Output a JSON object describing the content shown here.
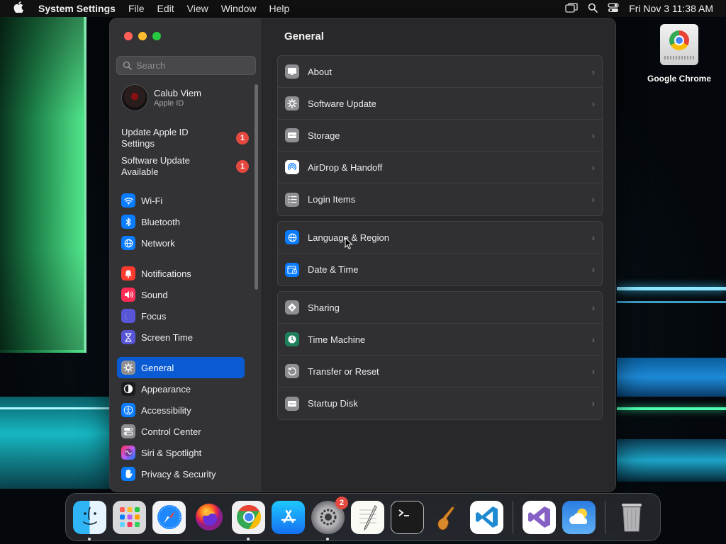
{
  "menubar": {
    "app_name": "System Settings",
    "items": [
      "File",
      "Edit",
      "View",
      "Window",
      "Help"
    ],
    "clock": "Fri Nov 3  11:38 AM"
  },
  "desktop": {
    "icon_label": "Google Chrome"
  },
  "window": {
    "search_placeholder": "Search",
    "account": {
      "name": "Calub Viem",
      "subtitle": "Apple ID"
    },
    "notices": [
      {
        "text": "Update Apple ID Settings",
        "badge": "1"
      },
      {
        "text": "Software Update Available",
        "badge": "1"
      }
    ],
    "sidebar_groups": [
      [
        {
          "label": "Wi-Fi",
          "icon": "wifi-icon",
          "color": "#0a7cff"
        },
        {
          "label": "Bluetooth",
          "icon": "bluetooth-icon",
          "color": "#0a7cff"
        },
        {
          "label": "Network",
          "icon": "globe-icon",
          "color": "#0a7cff"
        }
      ],
      [
        {
          "label": "Notifications",
          "icon": "bell-icon",
          "color": "#ff3b30"
        },
        {
          "label": "Sound",
          "icon": "speaker-icon",
          "color": "#ff2d55"
        },
        {
          "label": "Focus",
          "icon": "moon-icon",
          "color": "#5856d6"
        },
        {
          "label": "Screen Time",
          "icon": "hourglass-icon",
          "color": "#5856d6"
        }
      ],
      [
        {
          "label": "General",
          "icon": "gear-icon",
          "color": "#8e8e93",
          "active": true
        },
        {
          "label": "Appearance",
          "icon": "appearance-icon",
          "color": "#1c1c1e"
        },
        {
          "label": "Accessibility",
          "icon": "accessibility-icon",
          "color": "#0a7cff"
        },
        {
          "label": "Control Center",
          "icon": "toggles-icon",
          "color": "#8e8e93"
        },
        {
          "label": "Siri & Spotlight",
          "icon": "siri-icon",
          "color": "#bf5af2"
        },
        {
          "label": "Privacy & Security",
          "icon": "hand-icon",
          "color": "#0a7cff"
        }
      ]
    ],
    "content": {
      "title": "General",
      "cards": [
        [
          {
            "label": "About",
            "icon": "display-icon",
            "color": "#8e8e93"
          },
          {
            "label": "Software Update",
            "icon": "gear-icon",
            "color": "#8e8e93"
          },
          {
            "label": "Storage",
            "icon": "drive-icon",
            "color": "#8e8e93"
          },
          {
            "label": "AirDrop & Handoff",
            "icon": "airdrop-icon",
            "color": "#ffffff"
          },
          {
            "label": "Login Items",
            "icon": "list-icon",
            "color": "#8e8e93"
          }
        ],
        [
          {
            "label": "Language & Region",
            "icon": "globe-icon",
            "color": "#0a7cff"
          },
          {
            "label": "Date & Time",
            "icon": "calendar-clock-icon",
            "color": "#0a7cff"
          }
        ],
        [
          {
            "label": "Sharing",
            "icon": "sharing-icon",
            "color": "#8e8e93"
          },
          {
            "label": "Time Machine",
            "icon": "time-machine-icon",
            "color": "#1f7f5c"
          },
          {
            "label": "Transfer or Reset",
            "icon": "reset-icon",
            "color": "#8e8e93"
          },
          {
            "label": "Startup Disk",
            "icon": "disk-icon",
            "color": "#8e8e93"
          }
        ]
      ]
    }
  },
  "dock": {
    "apps": [
      {
        "name": "Finder",
        "icon": "finder-icon",
        "running": true
      },
      {
        "name": "Launchpad",
        "icon": "launchpad-icon"
      },
      {
        "name": "Safari",
        "icon": "safari-icon"
      },
      {
        "name": "Firefox",
        "icon": "firefox-icon"
      },
      {
        "name": "Google Chrome",
        "icon": "chrome-icon",
        "running": true
      },
      {
        "name": "App Store",
        "icon": "app-store-icon"
      },
      {
        "name": "System Settings",
        "icon": "system-settings-icon",
        "running": true,
        "badge": "2"
      },
      {
        "name": "TextEdit",
        "icon": "textedit-icon"
      },
      {
        "name": "Terminal",
        "icon": "terminal-icon"
      },
      {
        "name": "GarageBand",
        "icon": "garageband-icon"
      },
      {
        "name": "Visual Studio Code",
        "icon": "vscode-icon"
      },
      {
        "name": "Visual Studio",
        "icon": "visual-studio-icon"
      },
      {
        "name": "Weather",
        "icon": "weather-icon"
      },
      {
        "name": "Trash",
        "icon": "trash-icon"
      }
    ]
  }
}
